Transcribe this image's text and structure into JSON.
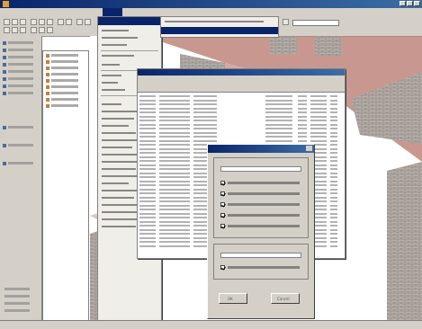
{
  "window": {
    "title": ""
  },
  "menubar": {
    "items": [
      "",
      "",
      "",
      "",
      "",
      "",
      "",
      "",
      "",
      ""
    ]
  },
  "context_menu": {
    "items": [
      "",
      "",
      "",
      "",
      "",
      "",
      "",
      "",
      "",
      "",
      "",
      "",
      "",
      "",
      "",
      "",
      "",
      "",
      "",
      "",
      "",
      "",
      "",
      "",
      "",
      "",
      "",
      ""
    ]
  },
  "dialog": {
    "title": "",
    "checkboxes": [
      {
        "label": "",
        "checked": true
      },
      {
        "label": "",
        "checked": true
      },
      {
        "label": "",
        "checked": true
      },
      {
        "label": "",
        "checked": true
      },
      {
        "label": "",
        "checked": true
      },
      {
        "label": "",
        "checked": true
      }
    ],
    "ok_label": "OK",
    "cancel_label": "Cancel"
  },
  "colors": {
    "title_blue": "#0a246a",
    "chrome": "#d4d0c8",
    "roof": "#c89890",
    "brick": "#b8b0aa"
  }
}
